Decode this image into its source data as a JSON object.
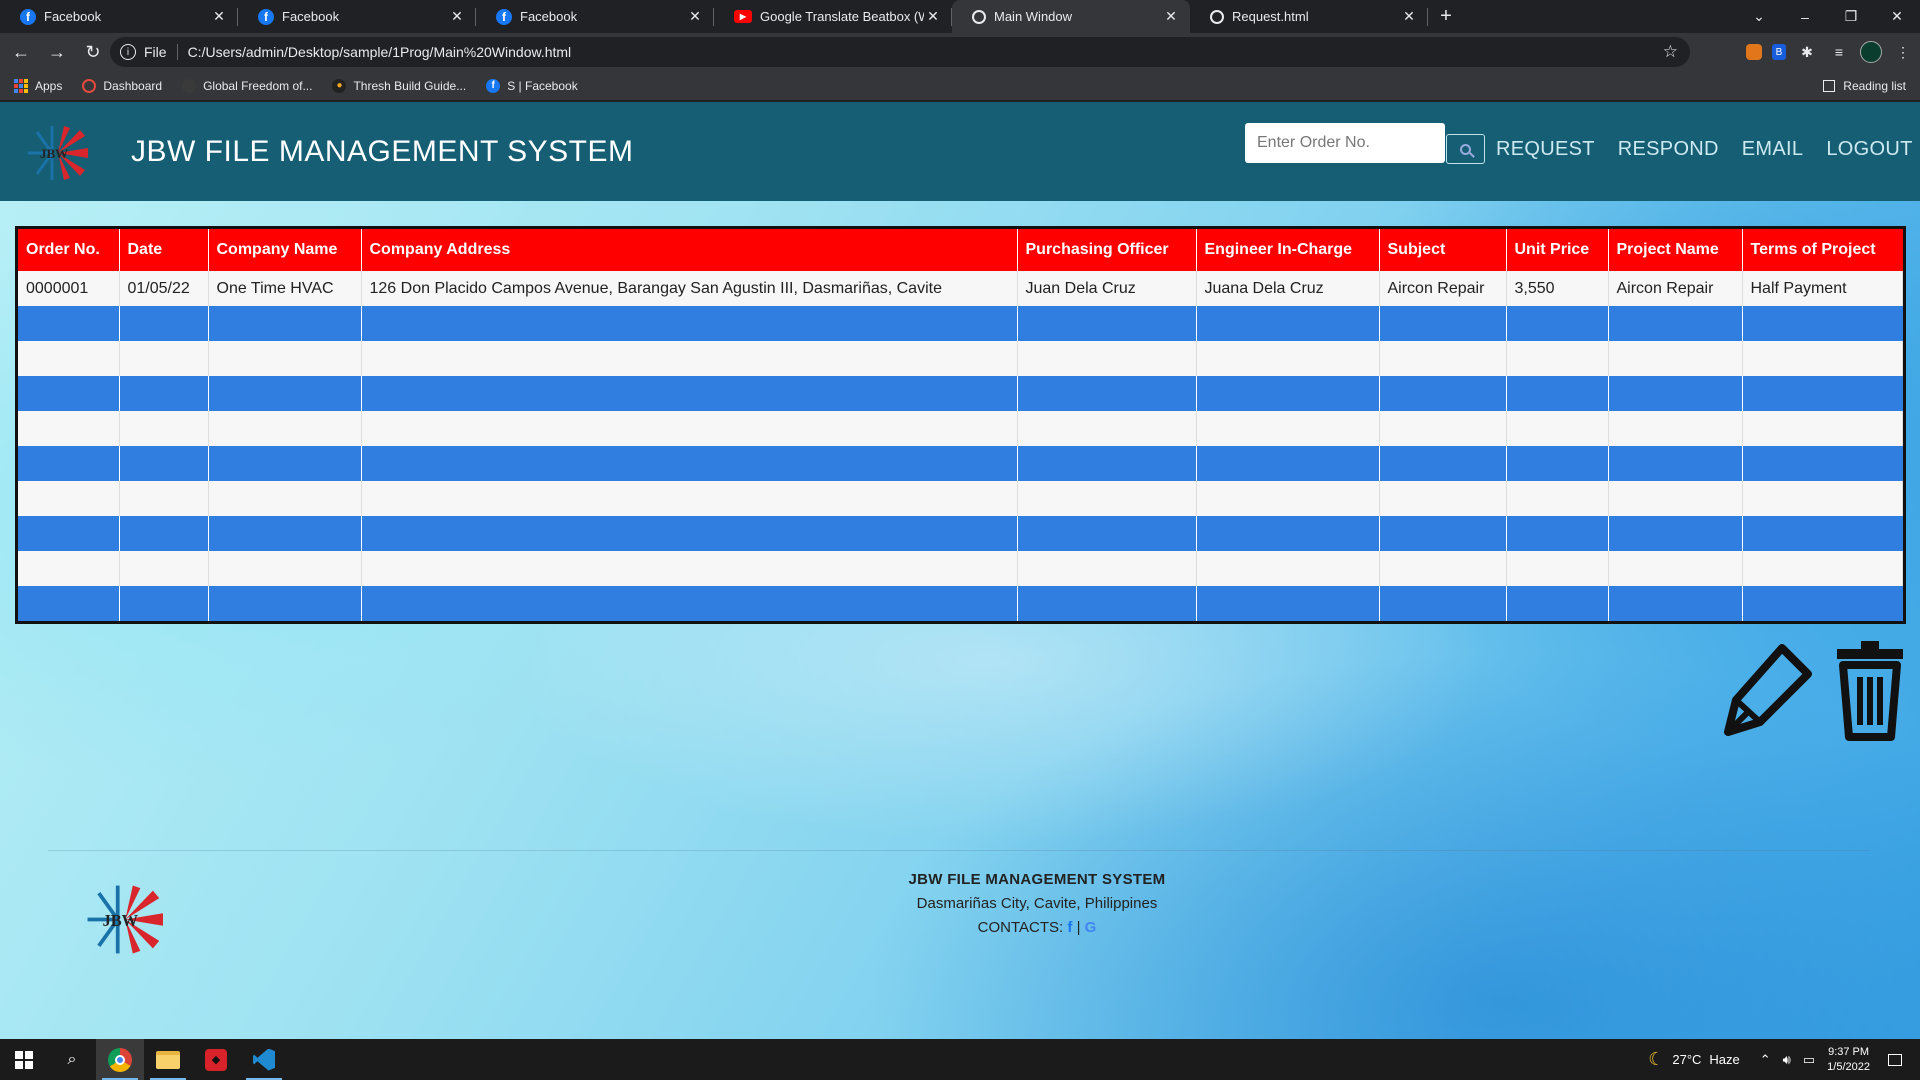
{
  "browser": {
    "tabs": [
      {
        "label": "Facebook",
        "icon": "facebook-icon",
        "active": false
      },
      {
        "label": "Facebook",
        "icon": "facebook-icon",
        "active": false
      },
      {
        "label": "Facebook",
        "icon": "facebook-icon",
        "active": false
      },
      {
        "label": "Google Translate Beatbox (WORKS)",
        "icon": "youtube-icon",
        "active": false
      },
      {
        "label": "Main Window",
        "icon": "globe-icon",
        "active": true
      },
      {
        "label": "Request.html",
        "icon": "globe-icon",
        "active": false
      }
    ],
    "address": {
      "scheme": "File",
      "url": "C:/Users/admin/Desktop/sample/1Prog/Main%20Window.html"
    },
    "bookmarks": [
      {
        "label": "Apps",
        "icon": "apps-grid-icon"
      },
      {
        "label": "Dashboard",
        "icon": "dashboard-icon"
      },
      {
        "label": "Global Freedom of...",
        "icon": "bookmark-site-icon"
      },
      {
        "label": "Thresh Build Guide...",
        "icon": "mobafire-icon"
      },
      {
        "label": "S | Facebook",
        "icon": "facebook-icon"
      }
    ],
    "reading_list": "Reading list"
  },
  "header": {
    "title": "JBW FILE MANAGEMENT SYSTEM",
    "search_placeholder": "Enter Order No.",
    "nav": [
      "REQUEST",
      "RESPOND",
      "EMAIL",
      "LOGOUT"
    ]
  },
  "table": {
    "columns": [
      "Order No.",
      "Date",
      "Company Name",
      "Company Address",
      "Purchasing Officer",
      "Engineer In-Charge",
      "Subject",
      "Unit Price",
      "Project Name",
      "Terms of Project"
    ],
    "rows": [
      [
        "0000001",
        "01/05/22",
        "One Time HVAC",
        "126 Don Placido Campos Avenue, Barangay San Agustin III, Dasmariñas, Cavite",
        "Juan Dela Cruz",
        "Juana Dela Cruz",
        "Aircon Repair",
        "3,550",
        "Aircon Repair",
        "Half Payment"
      ],
      [
        "",
        "",
        "",
        "",
        "",
        "",
        "",
        "",
        "",
        ""
      ],
      [
        "",
        "",
        "",
        "",
        "",
        "",
        "",
        "",
        "",
        ""
      ],
      [
        "",
        "",
        "",
        "",
        "",
        "",
        "",
        "",
        "",
        ""
      ],
      [
        "",
        "",
        "",
        "",
        "",
        "",
        "",
        "",
        "",
        ""
      ],
      [
        "",
        "",
        "",
        "",
        "",
        "",
        "",
        "",
        "",
        ""
      ],
      [
        "",
        "",
        "",
        "",
        "",
        "",
        "",
        "",
        "",
        ""
      ],
      [
        "",
        "",
        "",
        "",
        "",
        "",
        "",
        "",
        "",
        ""
      ],
      [
        "",
        "",
        "",
        "",
        "",
        "",
        "",
        "",
        "",
        ""
      ],
      [
        "",
        "",
        "",
        "",
        "",
        "",
        "",
        "",
        "",
        ""
      ]
    ],
    "header_color": "#fe0000",
    "stripe_color": "#2f7ee0"
  },
  "actions": {
    "edit_icon": "edit-pen-icon",
    "delete_icon": "trash-icon"
  },
  "footer": {
    "title": "JBW FILE MANAGEMENT SYSTEM",
    "address": "Dasmariñas City, Cavite, Philippines",
    "contacts_label": "CONTACTS:",
    "contact_icons": [
      "facebook-icon",
      "google-icon"
    ]
  },
  "taskbar": {
    "weather": "27°C",
    "weather_desc": "Haze",
    "time": "9:37 PM",
    "date": "1/5/2022"
  }
}
